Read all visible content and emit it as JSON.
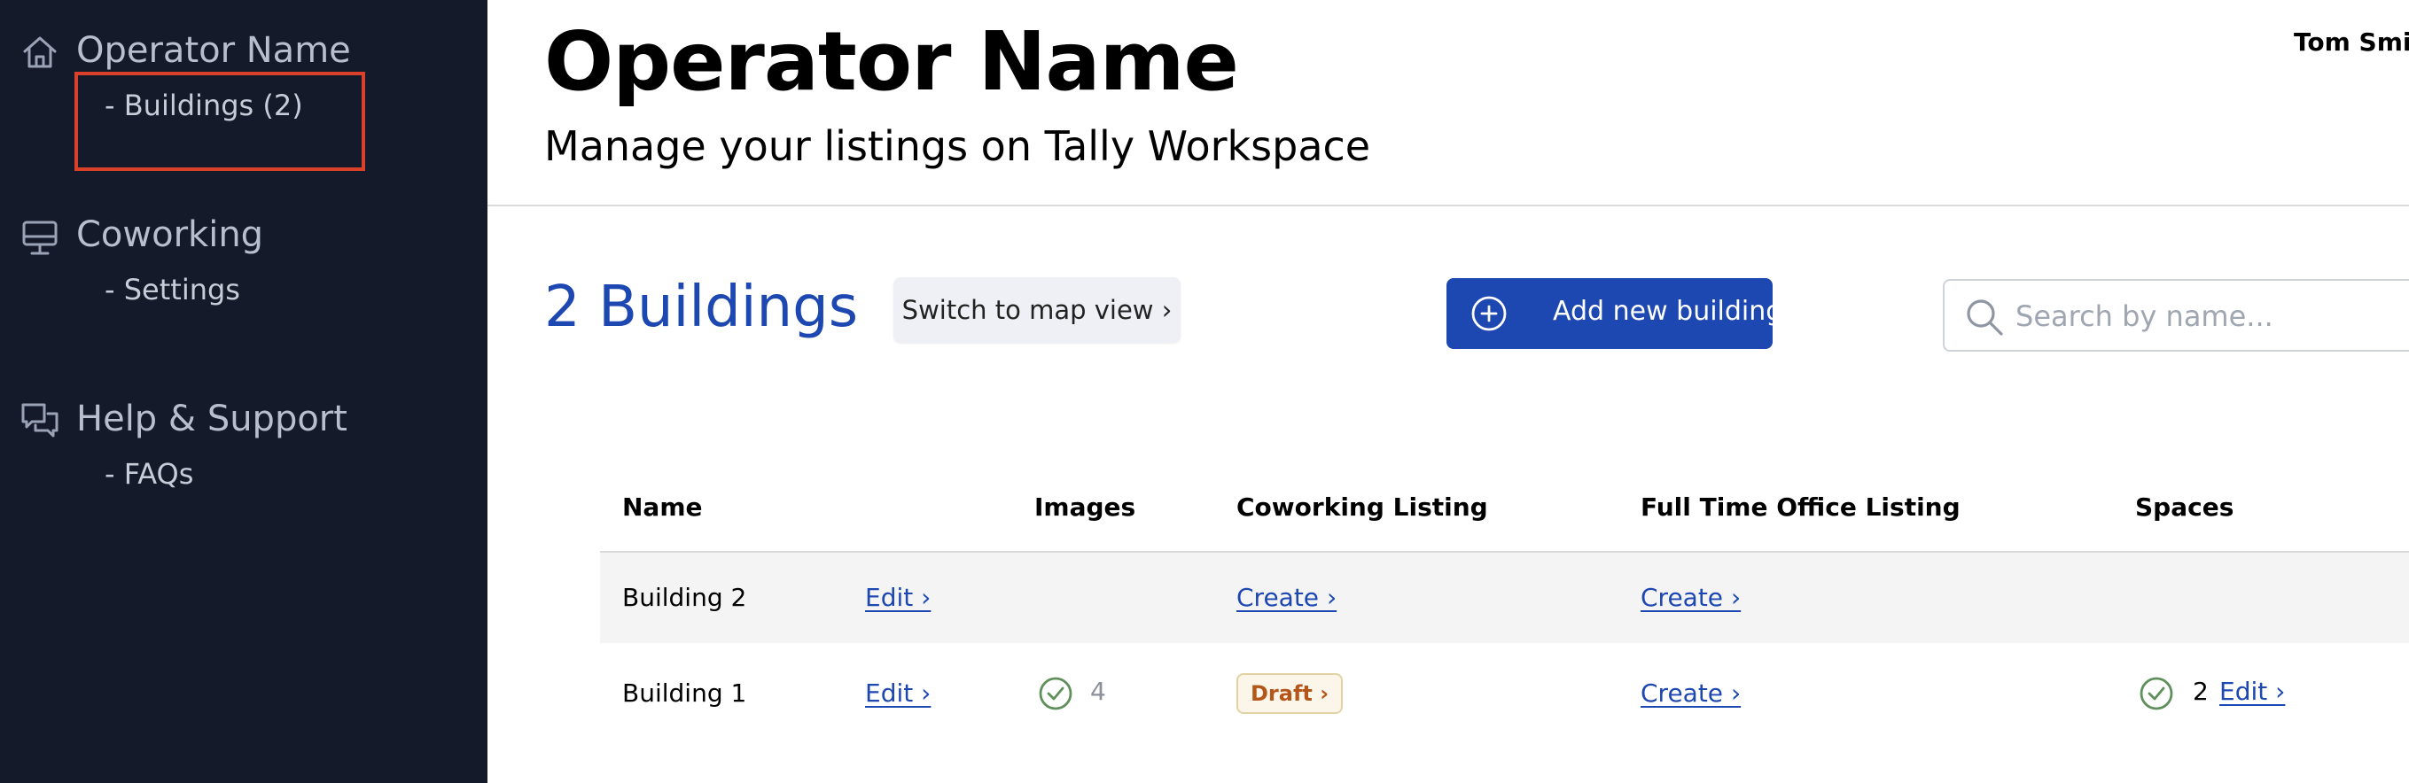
{
  "sidebar": {
    "groups": [
      {
        "icon": "home-icon",
        "title": "Operator Name",
        "sub": "- Buildings (2)"
      },
      {
        "icon": "monitor-icon",
        "title": "Coworking",
        "sub": "- Settings"
      },
      {
        "icon": "chat-bubbles-icon",
        "title": "Help & Support",
        "sub": "- FAQs"
      }
    ],
    "highlight_color": "#d9412b"
  },
  "header": {
    "title": "Operator Name",
    "subtitle": "Manage your listings on Tally Workspace",
    "user": "Tom Smit"
  },
  "toolbar": {
    "count_label": "2 Buildings",
    "map_view_label": "Switch to map view ›",
    "add_label": "Add new building",
    "search_placeholder": "Search by name..."
  },
  "table": {
    "headers": {
      "name": "Name",
      "images": "Images",
      "coworking": "Coworking Listing",
      "fulltime": "Full Time Office Listing",
      "spaces": "Spaces"
    },
    "rows": [
      {
        "name": "Building 2",
        "edit": "Edit ›",
        "images": "",
        "coworking": "Create ›",
        "fulltime": "Create ›",
        "spaces": ""
      },
      {
        "name": "Building 1",
        "edit": "Edit ›",
        "images": "4",
        "coworking": "Draft ›",
        "fulltime": "Create ›",
        "spaces": "2",
        "spaces_edit": "Edit ›"
      }
    ]
  },
  "colors": {
    "sidebar_bg": "#141a2a",
    "accent": "#1d47b1",
    "success": "#5f8f5a",
    "draft_text": "#b4561a"
  }
}
